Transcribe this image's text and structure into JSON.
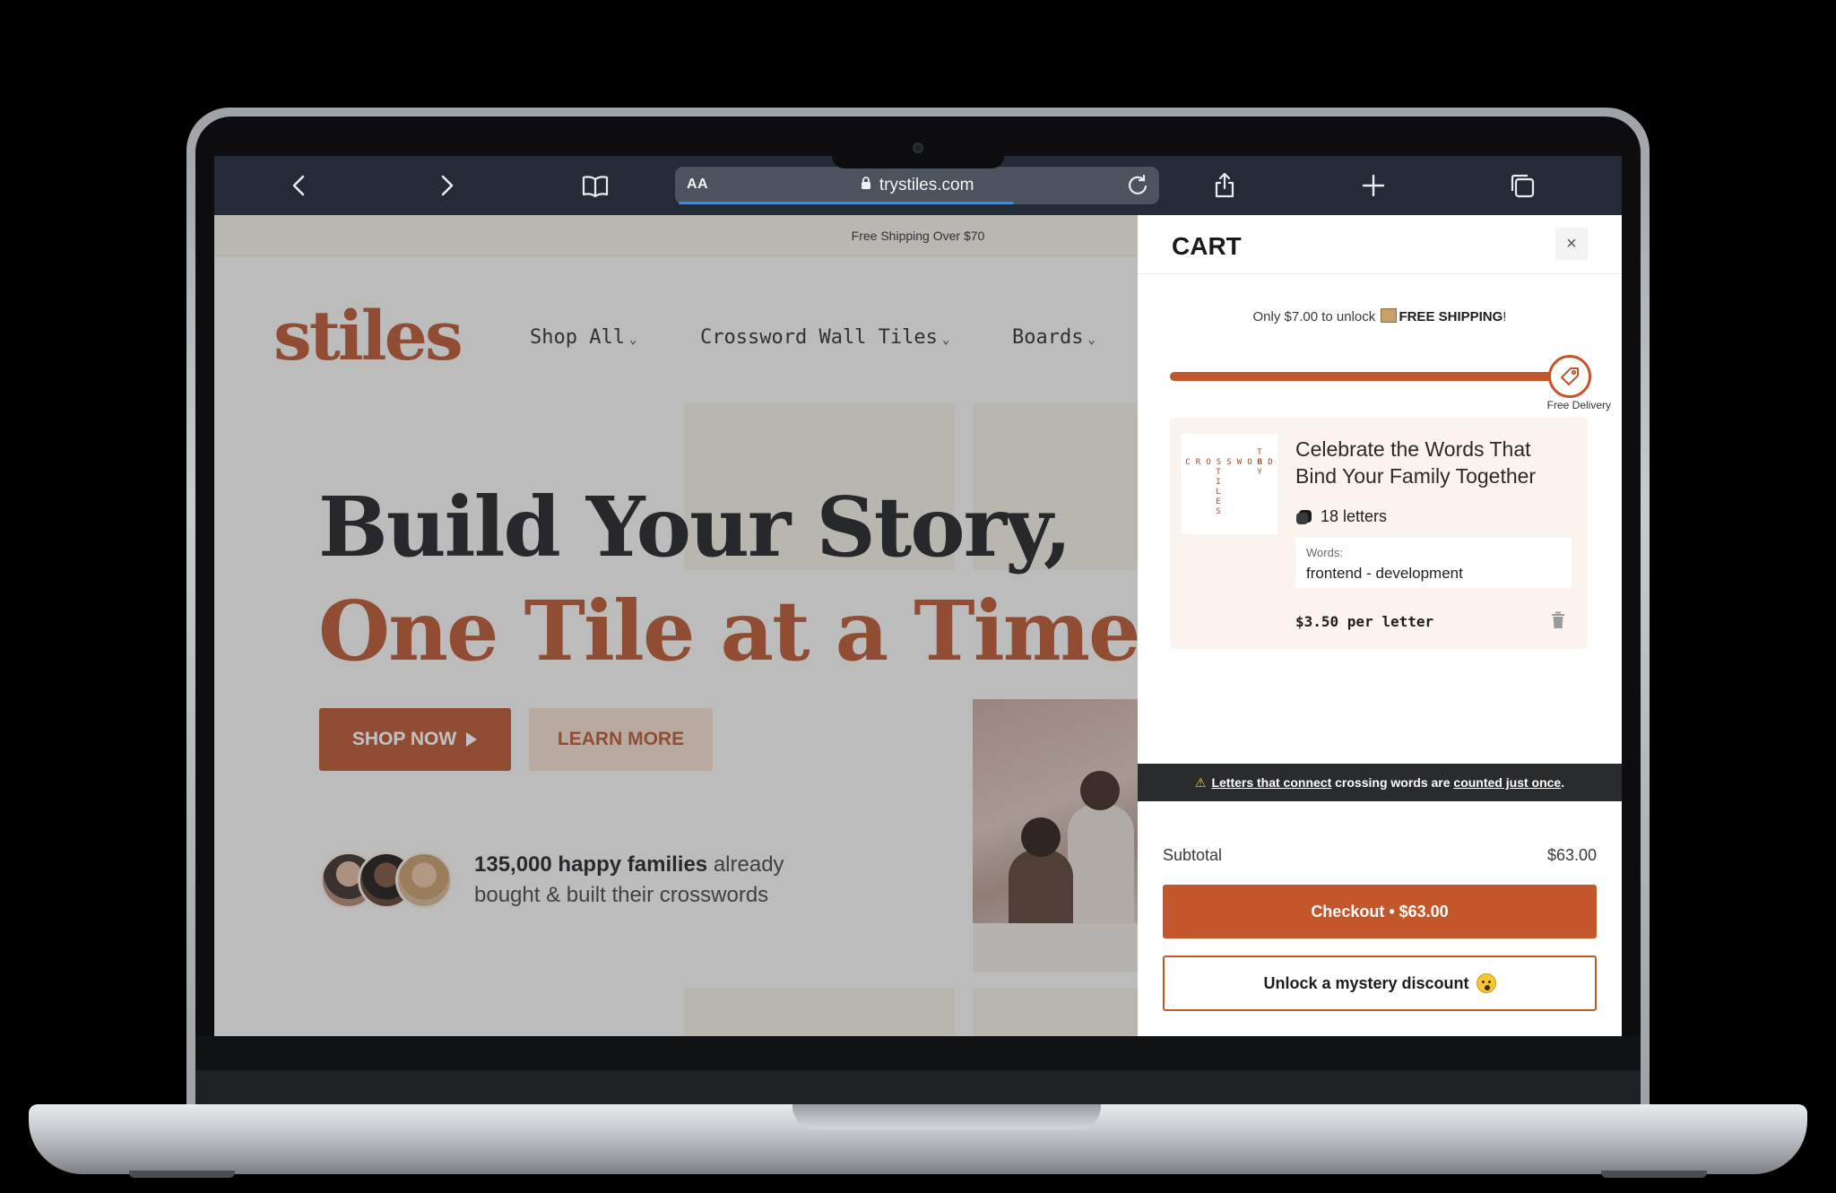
{
  "browser": {
    "reader_label": "AA",
    "url": "trystiles.com",
    "icons": [
      "back-icon",
      "forward-icon",
      "bookmarks-icon",
      "lock-icon",
      "reload-icon",
      "share-icon",
      "new-tab-icon",
      "tabs-icon"
    ],
    "load_progress": 0.7
  },
  "site": {
    "announcement": "Free Shipping Over $70",
    "logo": "stiles",
    "nav": [
      {
        "label": "Shop All"
      },
      {
        "label": "Crossword Wall Tiles"
      },
      {
        "label": "Boards"
      }
    ],
    "headline_line1": "Build Your Story,",
    "headline_line2": "One Tile at a Time.",
    "shop_now": "SHOP NOW",
    "learn_more": "LEARN MORE",
    "proof_bold": "135,000 happy families",
    "proof_rest1": " already",
    "proof_rest2": "bought & built their crosswords",
    "colors": {
      "brand": "#b8532a",
      "dark": "#1d1d1d",
      "cream": "#fbf7f2"
    }
  },
  "cart": {
    "title": "CART",
    "close": "×",
    "ship_prefix": "Only $7.00 to unlock ",
    "ship_bold": "FREE SHIPPING",
    "ship_suffix": "!",
    "progress": 0.97,
    "progress_label": "Free Delivery",
    "item": {
      "title": "Celebrate the Words That Bind Your Family Together",
      "letters": "18 letters",
      "words_label": "Words:",
      "words_value": "frontend - development",
      "price": "$3.50 per letter",
      "thumb_words": [
        "CROSSWORD",
        "TILES",
        "TOY"
      ]
    },
    "notice_link1": "Letters that connect",
    "notice_mid": " crossing words are ",
    "notice_link2": "counted just once",
    "notice_end": ".",
    "subtotal_label": "Subtotal",
    "subtotal_value": "$63.00",
    "checkout": "Checkout • $63.00",
    "mystery": "Unlock a mystery discount",
    "colors": {
      "accent": "#c4562c",
      "notice_bg": "#2a2b2d",
      "item_bg": "#fbf4ee"
    }
  }
}
